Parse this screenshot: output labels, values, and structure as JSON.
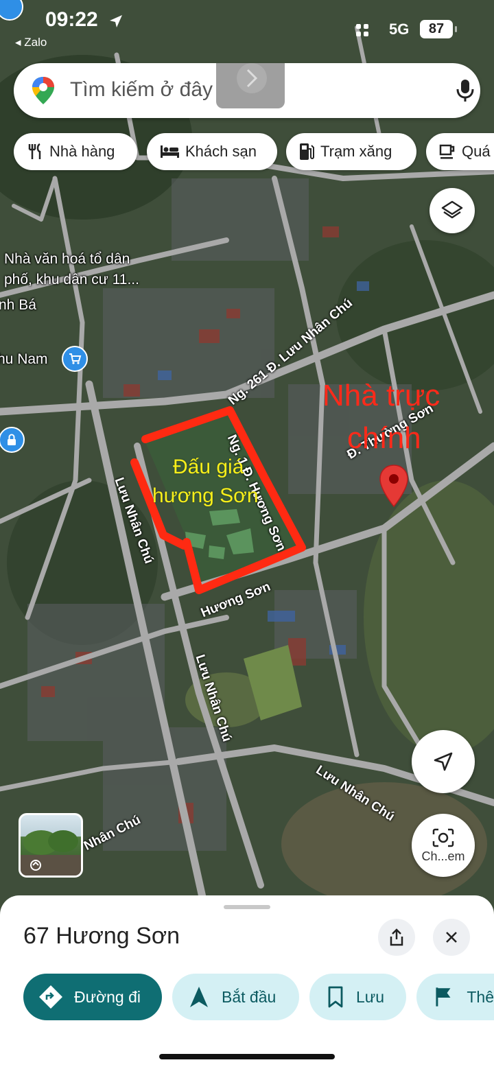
{
  "status_bar": {
    "time": "09:22",
    "back_app": "◂ Zalo",
    "network": "5G",
    "battery": "87"
  },
  "search": {
    "placeholder": "Tìm kiếm ở đây"
  },
  "chips": [
    {
      "label": "Nhà hàng",
      "icon": "fork-knife-icon"
    },
    {
      "label": "Khách sạn",
      "icon": "bed-icon"
    },
    {
      "label": "Trạm xăng",
      "icon": "gas-station-icon"
    },
    {
      "label": "Quá",
      "icon": "coffee-cup-icon"
    }
  ],
  "map": {
    "labels": {
      "community_house_line1": "Nhà văn hoá tổ dân",
      "community_house_line2": "phố, khu dân cư 11...",
      "partial_left_1": "nh Bá",
      "partial_left_2": "hu Nam"
    },
    "roads": {
      "lane_261": "Ng. 261 Đ. Lưu Nhân Chú",
      "lane_1": "Ng. 1 Đ. Hương Sơn",
      "luu_nhan_chu_1": "Lưu Nhân Chú",
      "luu_nhan_chu_2": "Lưu Nhân Chú",
      "luu_nhan_chu_3": "Lưu Nhân Chú",
      "luu_nhan_chu_4": "Nhân Chú",
      "huong_son": "Hương Sơn",
      "duong_thuong_son": "Đ. Thường Sơn"
    },
    "annotations": {
      "red_line1": "Nhà trực",
      "red_line2": "chính",
      "yellow_line1": "Đấu giá",
      "yellow_line2": "hương Sơn"
    }
  },
  "buttons": {
    "lens_label": "Ch...em"
  },
  "sheet": {
    "place_name": "67 Hương Sơn",
    "actions": [
      {
        "label": "Đường đi",
        "icon": "directions-icon"
      },
      {
        "label": "Bắt đầu",
        "icon": "navigation-arrow-icon"
      },
      {
        "label": "Lưu",
        "icon": "bookmark-icon"
      },
      {
        "label": "Thê",
        "icon": "flag-icon"
      }
    ]
  },
  "colors": {
    "primary_action": "#0f6e73",
    "secondary_action": "#d4f0f4",
    "annotation_red": "#ff2a1a",
    "annotation_yellow": "#f7ef1a",
    "place_pin": "#e53935"
  }
}
